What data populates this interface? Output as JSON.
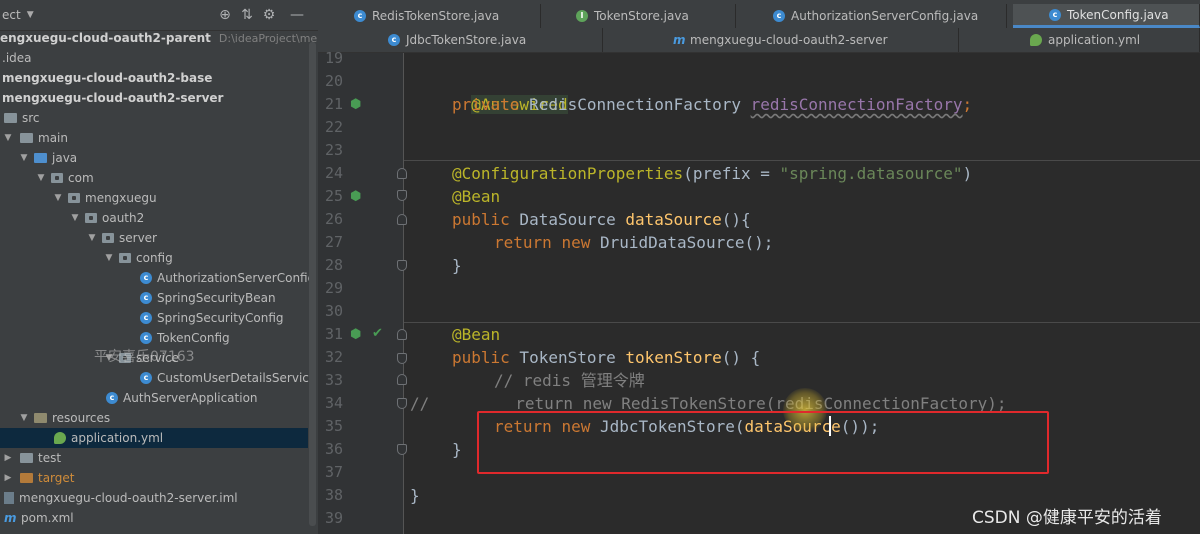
{
  "project_panel": {
    "header": "ect",
    "tree": [
      {
        "label": "engxuegu-cloud-oauth2-parent",
        "path": "D:\\ideaProject\\mengxu",
        "bold": true
      },
      {
        "label": ".idea"
      },
      {
        "label": "mengxuegu-cloud-oauth2-base",
        "bold": true
      },
      {
        "label": "mengxuegu-cloud-oauth2-server",
        "bold": true
      },
      {
        "label": "src"
      },
      {
        "label": "main"
      },
      {
        "label": "java"
      },
      {
        "label": "com"
      },
      {
        "label": "mengxuegu"
      },
      {
        "label": "oauth2"
      },
      {
        "label": "server"
      },
      {
        "label": "config"
      },
      {
        "label": "AuthorizationServerConfig"
      },
      {
        "label": "SpringSecurityBean"
      },
      {
        "label": "SpringSecurityConfig"
      },
      {
        "label": "TokenConfig"
      },
      {
        "label": "service"
      },
      {
        "label": "CustomUserDetailsService"
      },
      {
        "label": "AuthServerApplication"
      },
      {
        "label": "resources"
      },
      {
        "label": "application.yml",
        "selected": true
      },
      {
        "label": "test"
      },
      {
        "label": "target"
      },
      {
        "label": "mengxuegu-cloud-oauth2-server.iml"
      },
      {
        "label": "pom.xml"
      }
    ],
    "watermark": "平安喜乐07163"
  },
  "tabs": {
    "row1": [
      {
        "label": "RedisTokenStore.java"
      },
      {
        "label": "TokenStore.java"
      },
      {
        "label": "AuthorizationServerConfig.java"
      },
      {
        "label": "TokenConfig.java",
        "active": true
      }
    ],
    "row2": [
      {
        "label": "JdbcTokenStore.java"
      },
      {
        "label": "mengxuegu-cloud-oauth2-server"
      },
      {
        "label": "application.yml"
      }
    ]
  },
  "editor": {
    "line_numbers": [
      "19",
      "20",
      "21",
      "22",
      "23",
      "24",
      "25",
      "26",
      "27",
      "28",
      "29",
      "30",
      "31",
      "32",
      "33",
      "34",
      "35",
      "36",
      "37",
      "38",
      "39"
    ],
    "code": {
      "l20_ann": "@Autowired",
      "l21_kw": "private",
      "l21_type": " RedisConnectionFactory ",
      "l21_field": "redisConnectionFactory",
      "l21_semi": ";",
      "l24_ann": "@ConfigurationProperties",
      "l24_p1": "(",
      "l24_prefix": "prefix",
      "l24_eq": " = ",
      "l24_str": "\"spring.datasource\"",
      "l24_p2": ")",
      "l25_ann": "@Bean",
      "l26_kw": "public",
      "l26_type": " DataSource ",
      "l26_fn": "dataSource",
      "l26_rest": "(){",
      "l27_kw1": "return",
      "l27_kw2": "new",
      "l27_rest": " DruidDataSource();",
      "l28": "}",
      "l31_ann": "@Bean",
      "l32_kw": "public",
      "l32_type": " TokenStore ",
      "l32_fn": "tokenStore",
      "l32_rest": "() {",
      "l33_comment": "// redis 管理令牌",
      "l34_prefix": "//",
      "l34_comment": "return new RedisTokenStore(redisConnectionFactory);",
      "l35_kw1": "return",
      "l35_kw2": "new",
      "l35_mid": " JdbcTokenStore(",
      "l35_call": "dataSource",
      "l35_rest": "());",
      "l36": "}",
      "l38": "}"
    }
  },
  "csdn_watermark": "CSDN @健康平安的活着"
}
